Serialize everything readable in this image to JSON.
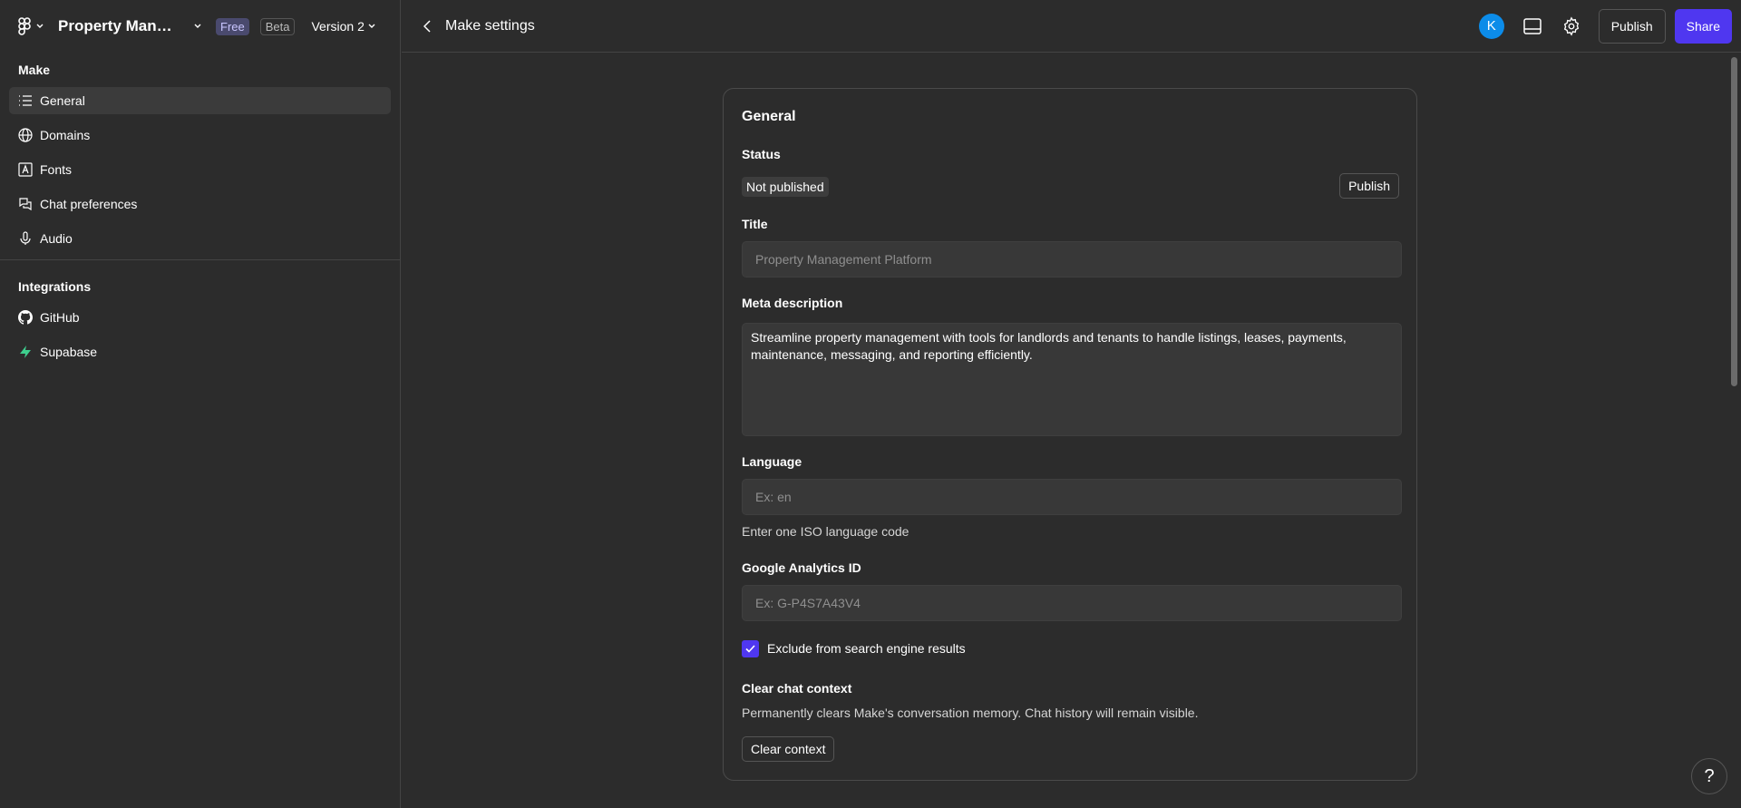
{
  "header": {
    "file_name": "Property Mana...",
    "plan_badge": "Free",
    "beta_badge": "Beta",
    "version": "Version 2"
  },
  "sidebar": {
    "make_title": "Make",
    "make_items": [
      {
        "label": "General",
        "icon": "list-icon",
        "active": true
      },
      {
        "label": "Domains",
        "icon": "globe-icon"
      },
      {
        "label": "Fonts",
        "icon": "font-icon"
      },
      {
        "label": "Chat preferences",
        "icon": "chat-icon"
      },
      {
        "label": "Audio",
        "icon": "microphone-icon"
      }
    ],
    "integrations_title": "Integrations",
    "integration_items": [
      {
        "label": "GitHub",
        "icon": "github-icon"
      },
      {
        "label": "Supabase",
        "icon": "supabase-icon"
      }
    ]
  },
  "topbar": {
    "title": "Make settings",
    "avatar_initial": "K",
    "publish_label": "Publish",
    "share_label": "Share"
  },
  "general": {
    "title": "General",
    "status_label": "Status",
    "status_value": "Not published",
    "publish_label": "Publish",
    "title_label": "Title",
    "title_placeholder": "Property Management Platform",
    "meta_label": "Meta description",
    "meta_value": "Streamline property management with tools for landlords and tenants to handle listings, leases, payments, maintenance, messaging, and reporting efficiently.",
    "language_label": "Language",
    "language_placeholder": "Ex: en",
    "language_hint": "Enter one ISO language code",
    "ga_label": "Google Analytics ID",
    "ga_placeholder": "Ex: G-P4S7A43V4",
    "exclude_label": "Exclude from search engine results",
    "exclude_checked": true,
    "clear_title": "Clear chat context",
    "clear_desc": "Permanently clears Make's conversation memory. Chat history will remain visible.",
    "clear_button": "Clear context"
  },
  "help_label": "?",
  "colors": {
    "background": "#2c2c2c",
    "accent": "#4f37f0",
    "avatar": "#0c8ce9",
    "supabase": "#3ecf8e"
  }
}
